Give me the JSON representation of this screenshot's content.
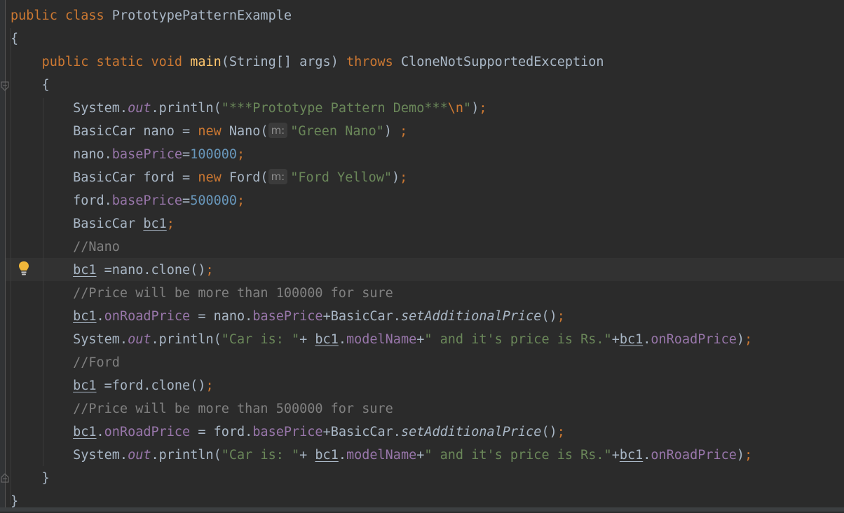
{
  "editor": {
    "lines": [
      {
        "id": "l1",
        "parts": [
          [
            "kw",
            "public"
          ],
          [
            "t",
            " "
          ],
          [
            "kw",
            "class"
          ],
          [
            "t",
            " PrototypePatternExample"
          ]
        ]
      },
      {
        "id": "l2",
        "parts": [
          [
            "t",
            "{"
          ]
        ]
      },
      {
        "id": "l3",
        "parts": [
          [
            "t",
            "    "
          ],
          [
            "kw",
            "public"
          ],
          [
            "t",
            " "
          ],
          [
            "kw",
            "static"
          ],
          [
            "t",
            " "
          ],
          [
            "kw",
            "void"
          ],
          [
            "t",
            " "
          ],
          [
            "fn",
            "main"
          ],
          [
            "t",
            "(String[] args) "
          ],
          [
            "kw",
            "throws"
          ],
          [
            "t",
            " CloneNotSupportedException"
          ]
        ]
      },
      {
        "id": "l4",
        "parts": [
          [
            "t",
            "    {"
          ]
        ]
      },
      {
        "id": "l5",
        "parts": [
          [
            "t",
            "        System."
          ],
          [
            "sfld",
            "out"
          ],
          [
            "t",
            ".println("
          ],
          [
            "str",
            "\"***Prototype Pattern Demo***"
          ],
          [
            "esc",
            "\\n"
          ],
          [
            "str",
            "\""
          ],
          [
            "t",
            ")"
          ],
          [
            "kw",
            ";"
          ]
        ]
      },
      {
        "id": "l6",
        "parts": [
          [
            "t",
            "        BasicCar nano = "
          ],
          [
            "kw",
            "new"
          ],
          [
            "t",
            " Nano("
          ],
          [
            "hint",
            "m:"
          ],
          [
            "str",
            "\"Green Nano\""
          ],
          [
            "t",
            ") "
          ],
          [
            "kw",
            ";"
          ]
        ]
      },
      {
        "id": "l7",
        "parts": [
          [
            "t",
            "        nano."
          ],
          [
            "fld",
            "basePrice"
          ],
          [
            "t",
            "="
          ],
          [
            "num",
            "100000"
          ],
          [
            "kw",
            ";"
          ]
        ]
      },
      {
        "id": "l8",
        "parts": [
          [
            "t",
            "        BasicCar ford = "
          ],
          [
            "kw",
            "new"
          ],
          [
            "t",
            " Ford("
          ],
          [
            "hint",
            "m:"
          ],
          [
            "str",
            "\"Ford Yellow\""
          ],
          [
            "t",
            ")"
          ],
          [
            "kw",
            ";"
          ]
        ]
      },
      {
        "id": "l9",
        "parts": [
          [
            "t",
            "        ford."
          ],
          [
            "fld",
            "basePrice"
          ],
          [
            "t",
            "="
          ],
          [
            "num",
            "500000"
          ],
          [
            "kw",
            ";"
          ]
        ]
      },
      {
        "id": "l10",
        "parts": [
          [
            "t",
            "        BasicCar "
          ],
          [
            "u",
            "bc1"
          ],
          [
            "kw",
            ";"
          ]
        ]
      },
      {
        "id": "l11",
        "parts": [
          [
            "t",
            "        "
          ],
          [
            "cm",
            "//Nano"
          ]
        ]
      },
      {
        "id": "l12",
        "current": true,
        "parts": [
          [
            "t",
            "        "
          ],
          [
            "u",
            "bc1"
          ],
          [
            "t",
            " =nano.clone()"
          ],
          [
            "kw",
            ";"
          ]
        ]
      },
      {
        "id": "l13",
        "parts": [
          [
            "t",
            "        "
          ],
          [
            "cm",
            "//Price will be more than 100000 for sure"
          ]
        ]
      },
      {
        "id": "l14",
        "parts": [
          [
            "t",
            "        "
          ],
          [
            "u",
            "bc1"
          ],
          [
            "t",
            "."
          ],
          [
            "fld",
            "onRoadPrice"
          ],
          [
            "t",
            " = nano."
          ],
          [
            "fld",
            "basePrice"
          ],
          [
            "t",
            "+BasicCar."
          ],
          [
            "sm",
            "setAdditionalPrice"
          ],
          [
            "t",
            "()"
          ],
          [
            "kw",
            ";"
          ]
        ]
      },
      {
        "id": "l15",
        "parts": [
          [
            "t",
            "        System."
          ],
          [
            "sfld",
            "out"
          ],
          [
            "t",
            ".println("
          ],
          [
            "str",
            "\"Car is: \""
          ],
          [
            "t",
            "+ "
          ],
          [
            "u",
            "bc1"
          ],
          [
            "t",
            "."
          ],
          [
            "fld",
            "modelName"
          ],
          [
            "t",
            "+"
          ],
          [
            "str",
            "\" and it's price is Rs.\""
          ],
          [
            "t",
            "+"
          ],
          [
            "u",
            "bc1"
          ],
          [
            "t",
            "."
          ],
          [
            "fld",
            "onRoadPrice"
          ],
          [
            "t",
            ")"
          ],
          [
            "kw",
            ";"
          ]
        ]
      },
      {
        "id": "l16",
        "parts": [
          [
            "t",
            "        "
          ],
          [
            "cm",
            "//Ford"
          ]
        ]
      },
      {
        "id": "l17",
        "parts": [
          [
            "t",
            "        "
          ],
          [
            "u",
            "bc1"
          ],
          [
            "t",
            " =ford.clone()"
          ],
          [
            "kw",
            ";"
          ]
        ]
      },
      {
        "id": "l18",
        "parts": [
          [
            "t",
            "        "
          ],
          [
            "cm",
            "//Price will be more than 500000 for sure"
          ]
        ]
      },
      {
        "id": "l19",
        "parts": [
          [
            "t",
            "        "
          ],
          [
            "u",
            "bc1"
          ],
          [
            "t",
            "."
          ],
          [
            "fld",
            "onRoadPrice"
          ],
          [
            "t",
            " = ford."
          ],
          [
            "fld",
            "basePrice"
          ],
          [
            "t",
            "+BasicCar."
          ],
          [
            "sm",
            "setAdditionalPrice"
          ],
          [
            "t",
            "()"
          ],
          [
            "kw",
            ";"
          ]
        ]
      },
      {
        "id": "l20",
        "parts": [
          [
            "t",
            "        System."
          ],
          [
            "sfld",
            "out"
          ],
          [
            "t",
            ".println("
          ],
          [
            "str",
            "\"Car is: \""
          ],
          [
            "t",
            "+ "
          ],
          [
            "u",
            "bc1"
          ],
          [
            "t",
            "."
          ],
          [
            "fld",
            "modelName"
          ],
          [
            "t",
            "+"
          ],
          [
            "str",
            "\" and it's price is Rs.\""
          ],
          [
            "t",
            "+"
          ],
          [
            "u",
            "bc1"
          ],
          [
            "t",
            "."
          ],
          [
            "fld",
            "onRoadPrice"
          ],
          [
            "t",
            ")"
          ],
          [
            "kw",
            ";"
          ]
        ]
      },
      {
        "id": "l21",
        "parts": [
          [
            "t",
            "    }"
          ]
        ]
      },
      {
        "id": "l22",
        "parts": [
          [
            "t",
            "}"
          ]
        ]
      }
    ]
  },
  "icons": {
    "intention": "lightbulb-icon",
    "fold": "fold-marker-icon"
  },
  "colors": {
    "background": "#2b2b2b",
    "keyword": "#cc7832",
    "string": "#6a8759",
    "number": "#6897bb",
    "field": "#9876aa",
    "comment": "#808080",
    "method": "#ffc66d",
    "text": "#a9b7c6"
  }
}
